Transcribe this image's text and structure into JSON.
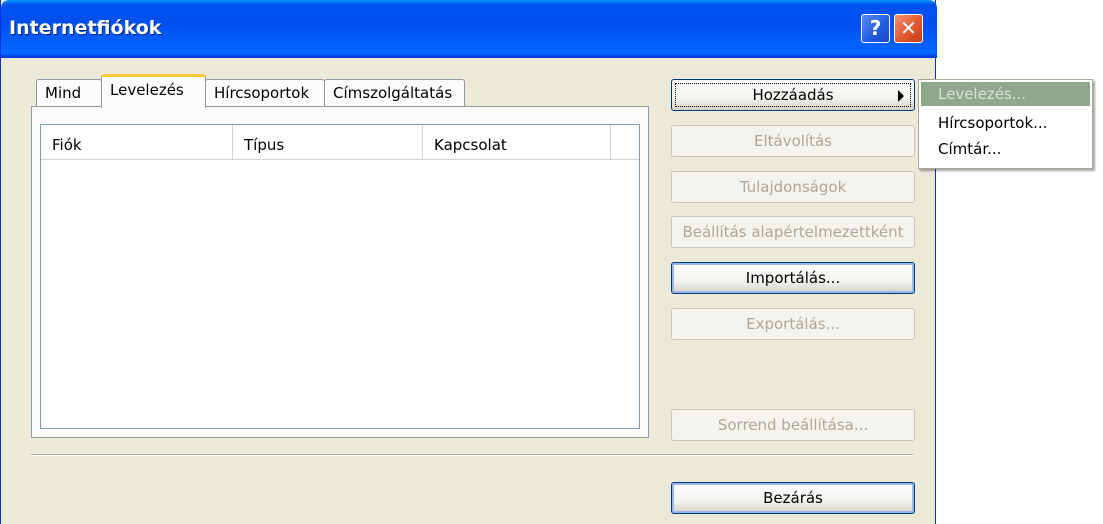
{
  "window": {
    "title": "Internetfiókok",
    "help_glyph": "?",
    "close_glyph": "✕"
  },
  "tabs": [
    {
      "label": "Mind",
      "active": false
    },
    {
      "label": "Levelezés",
      "active": true
    },
    {
      "label": "Hírcsoportok",
      "active": false
    },
    {
      "label": "Címszolgáltatás",
      "active": false
    }
  ],
  "list": {
    "columns": [
      "Fiók",
      "Típus",
      "Kapcsolat"
    ],
    "rows": []
  },
  "buttons": {
    "add": "Hozzáadás",
    "remove": "Eltávolítás",
    "properties": "Tulajdonságok",
    "set_default": "Beállítás alapértelmezettként",
    "import": "Importálás...",
    "export": "Exportálás...",
    "set_order": "Sorrend beállítása...",
    "close": "Bezárás"
  },
  "add_menu": {
    "items": [
      "Levelezés...",
      "Hírcsoportok...",
      "Címtár..."
    ],
    "highlighted_index": 0
  },
  "colors": {
    "titlebar": "#0053ee",
    "face": "#ece9d8",
    "tab_highlight": "#ffc83c",
    "menu_highlight": "#8fa88c"
  },
  "icons": {
    "submenu_arrow": "triangle-right-icon"
  }
}
